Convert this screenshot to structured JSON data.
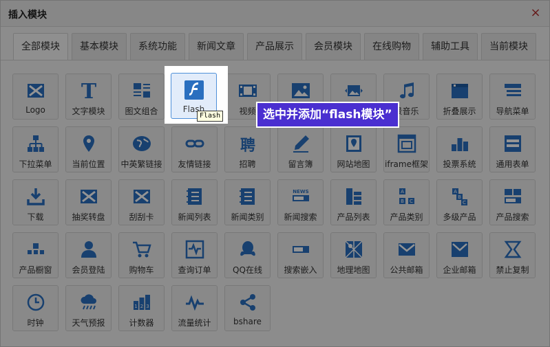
{
  "dialog": {
    "title": "插入模块",
    "close_glyph": "×"
  },
  "tabs": [
    "全部模块",
    "基本模块",
    "系统功能",
    "新闻文章",
    "产品展示",
    "会员模块",
    "在线购物",
    "辅助工具",
    "当前模块"
  ],
  "active_tab": "全部模块",
  "modules": [
    {
      "label": "Logo",
      "icon": "logo-icon"
    },
    {
      "label": "文字模块",
      "icon": "text-icon"
    },
    {
      "label": "图文组合",
      "icon": "image-text-icon"
    },
    {
      "label": "Flash",
      "icon": "flash-icon"
    },
    {
      "label": "视频",
      "icon": "video-icon"
    },
    {
      "label": "",
      "icon": "image-icon"
    },
    {
      "label": "",
      "icon": "slideshow-icon"
    },
    {
      "label": "景音乐",
      "icon": "music-icon"
    },
    {
      "label": "折叠展示",
      "icon": "folder-icon"
    },
    {
      "label": "导航菜单",
      "icon": "nav-menu-icon"
    },
    {
      "label": "下拉菜单",
      "icon": "dropdown-menu-icon"
    },
    {
      "label": "当前位置",
      "icon": "location-pin-icon"
    },
    {
      "label": "中英繁链接",
      "icon": "globe-icon"
    },
    {
      "label": "友情链接",
      "icon": "link-icon"
    },
    {
      "label": "招聘",
      "icon": "recruit-icon"
    },
    {
      "label": "留言簿",
      "icon": "pencil-icon"
    },
    {
      "label": "网站地图",
      "icon": "sitemap-icon"
    },
    {
      "label": "iframe框架",
      "icon": "iframe-icon"
    },
    {
      "label": "投票系统",
      "icon": "vote-icon"
    },
    {
      "label": "通用表单",
      "icon": "form-icon"
    },
    {
      "label": "下载",
      "icon": "download-icon"
    },
    {
      "label": "抽奖转盘",
      "icon": "lottery-icon"
    },
    {
      "label": "刮刮卡",
      "icon": "scratch-card-icon"
    },
    {
      "label": "新闻列表",
      "icon": "news-list-icon"
    },
    {
      "label": "新闻类别",
      "icon": "news-category-icon"
    },
    {
      "label": "新闻搜索",
      "icon": "news-search-icon"
    },
    {
      "label": "产品列表",
      "icon": "product-list-icon"
    },
    {
      "label": "产品类别",
      "icon": "product-category-icon"
    },
    {
      "label": "多级产品",
      "icon": "multilevel-product-icon"
    },
    {
      "label": "产品搜索",
      "icon": "product-search-icon"
    },
    {
      "label": "产品橱窗",
      "icon": "showcase-icon"
    },
    {
      "label": "会员登陆",
      "icon": "member-login-icon"
    },
    {
      "label": "购物车",
      "icon": "cart-icon"
    },
    {
      "label": "查询订单",
      "icon": "order-query-icon"
    },
    {
      "label": "QQ在线",
      "icon": "qq-icon"
    },
    {
      "label": "搜索嵌入",
      "icon": "search-embed-icon"
    },
    {
      "label": "地理地图",
      "icon": "map-icon"
    },
    {
      "label": "公共邮箱",
      "icon": "mail-icon"
    },
    {
      "label": "企业邮箱",
      "icon": "enterprise-mail-icon"
    },
    {
      "label": "禁止复制",
      "icon": "no-copy-icon"
    },
    {
      "label": "时钟",
      "icon": "clock-icon"
    },
    {
      "label": "天气预报",
      "icon": "weather-icon"
    },
    {
      "label": "计数器",
      "icon": "counter-icon"
    },
    {
      "label": "流量统计",
      "icon": "traffic-stats-icon"
    },
    {
      "label": "bshare",
      "icon": "share-icon"
    }
  ],
  "highlight": {
    "label": "Flash",
    "tooltip": "Flash"
  },
  "callout": {
    "text": "选中并添加“flash模块”"
  },
  "colors": {
    "icon": "#2a6fbf",
    "callout_bg": "#4a2fd0",
    "tooltip_bg": "#ffffe1"
  }
}
